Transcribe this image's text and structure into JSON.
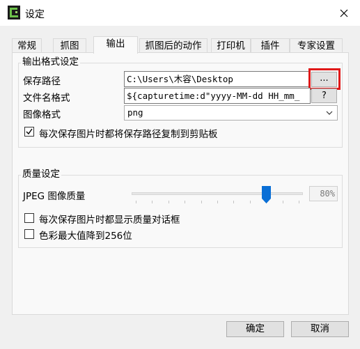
{
  "window": {
    "title": "设定"
  },
  "tabs": [
    "常规",
    "抓图",
    "输出",
    "抓图后的动作",
    "打印机",
    "插件",
    "专家设置"
  ],
  "output_group": {
    "title": "输出格式设定",
    "save_path_label": "保存路径",
    "save_path_value": "C:\\Users\\木容\\Desktop",
    "browse_label": "...",
    "filename_label": "文件名格式",
    "filename_value": "${capturetime:d\"yyyy-MM-dd HH_mm_",
    "help_label": "?",
    "image_format_label": "图像格式",
    "image_format_value": "png",
    "copy_path_label": "每次保存图片时都将保存路径复制到剪贴板",
    "copy_path_checked": true
  },
  "quality_group": {
    "title": "质量设定",
    "jpeg_label": "JPEG 图像质量",
    "jpeg_value": 80,
    "jpeg_value_text": "80%",
    "show_dialog_label": "每次保存图片时都显示质量对话框",
    "show_dialog_checked": false,
    "reduce_colors_label": "色彩最大值降到256位",
    "reduce_colors_checked": false
  },
  "buttons": {
    "ok": "确定",
    "cancel": "取消"
  },
  "colors": {
    "highlight": "#e01919",
    "thumb": "#0a6fd6"
  }
}
